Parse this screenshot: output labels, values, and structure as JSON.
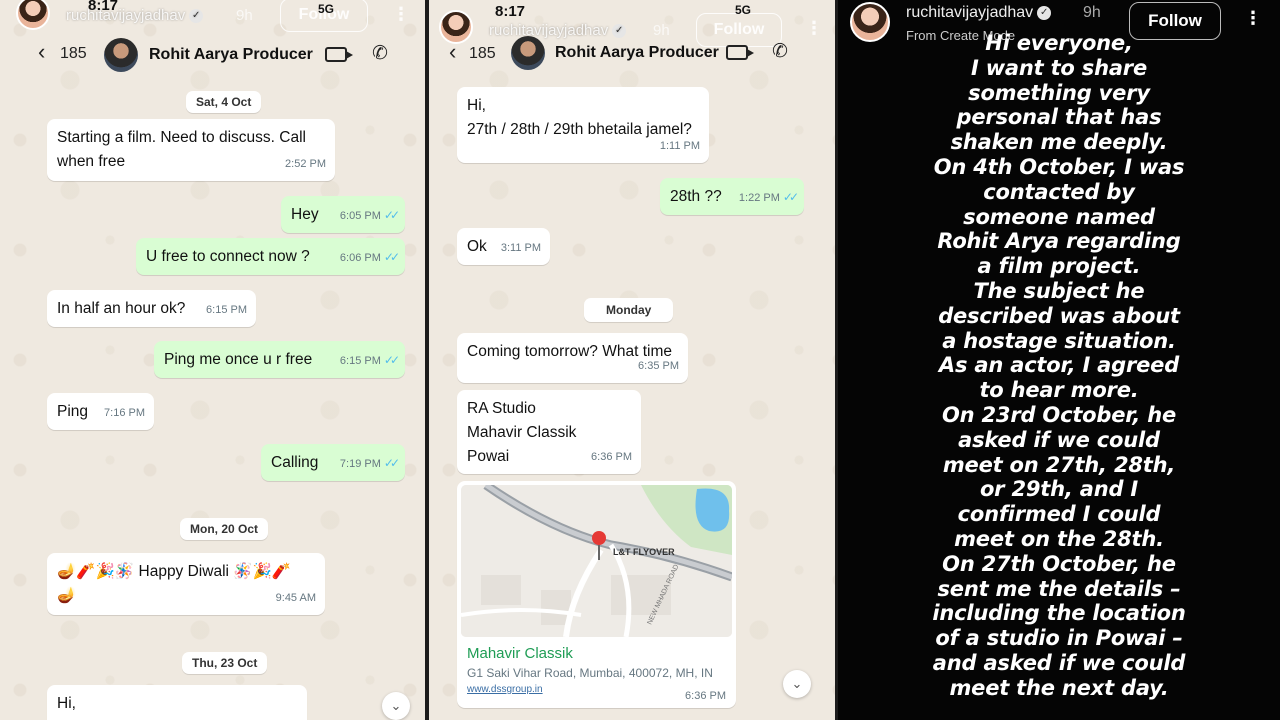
{
  "story": {
    "username": "ruchitavijayjadhav",
    "age": "9h",
    "follow_label": "Follow",
    "subcaption": "From Create Mode",
    "text_lines": [
      "Hi everyone,",
      "I want to share",
      "something very",
      "personal that has",
      "shaken me deeply.",
      "On 4th October, I was",
      "contacted by",
      "someone named",
      "Rohit Arya regarding",
      "a film project.",
      "The subject he",
      "described was about",
      "a hostage situation.",
      "As an actor, I agreed",
      "to hear more.",
      "On 23rd October, he",
      "asked if we could",
      "meet on 27th, 28th,",
      "or 29th, and I",
      "confirmed I could",
      "meet on the 28th.",
      "On 27th October, he",
      "sent me the details –",
      "including the location",
      "of a studio in Powai –",
      "and asked if we could",
      "meet the next day."
    ]
  },
  "phone": {
    "clock": "8:17",
    "network": "5G"
  },
  "chat": {
    "unread_count": "185",
    "contact_name": "Rohit Aarya Producer",
    "panel1": {
      "dates": [
        "Sat, 4 Oct",
        "Mon, 20 Oct",
        "Thu, 23 Oct"
      ],
      "messages": [
        {
          "dir": "in",
          "text": "Starting a film. Need to discuss. Call",
          "text2": "when free",
          "time": "2:52 PM"
        },
        {
          "dir": "out",
          "text": "Hey",
          "time": "6:05 PM"
        },
        {
          "dir": "out",
          "text": "U free to connect now ?",
          "time": "6:06 PM"
        },
        {
          "dir": "in",
          "text": "In half an hour ok?",
          "time": "6:15 PM"
        },
        {
          "dir": "out",
          "text": "Ping me once u r free",
          "time": "6:15 PM"
        },
        {
          "dir": "in",
          "text": "Ping",
          "time": "7:16 PM"
        },
        {
          "dir": "out",
          "text": "Calling",
          "time": "7:19 PM"
        },
        {
          "dir": "in",
          "text": "🪔🧨🎉🪅 Happy Diwali 🪅🎉🧨",
          "text2": "🪔",
          "time": "9:45 AM"
        },
        {
          "dir": "in",
          "text": "Hi,"
        }
      ]
    },
    "panel2": {
      "dates": [
        "Monday"
      ],
      "messages": [
        {
          "dir": "in",
          "text": "Hi,",
          "text2": "27th / 28th / 29th bhetaila jamel?",
          "time": "1:11 PM"
        },
        {
          "dir": "out",
          "text": "28th ??",
          "time": "1:22 PM"
        },
        {
          "dir": "in",
          "text": "Ok",
          "time": "3:11 PM"
        },
        {
          "dir": "in",
          "text": "Coming tomorrow? What time",
          "time": "6:35 PM"
        },
        {
          "dir": "in",
          "text": "RA Studio",
          "text2": "Mahavir Classik",
          "text3": "Powai",
          "time": "6:36 PM"
        }
      ],
      "location": {
        "name": "Mahavir Classik",
        "address": "G1 Saki Vihar Road, Mumbai, 400072, MH, IN",
        "link": "www.dssgroup.in",
        "time": "6:36 PM",
        "road_label": "L&T FLYOVER",
        "road_label2": "NEW MHADA ROAD"
      }
    }
  },
  "colors": {
    "outgoing": "#d9fdd3",
    "incoming": "#ffffff",
    "read_tick": "#53bdeb",
    "location_green": "#1f9d55"
  }
}
